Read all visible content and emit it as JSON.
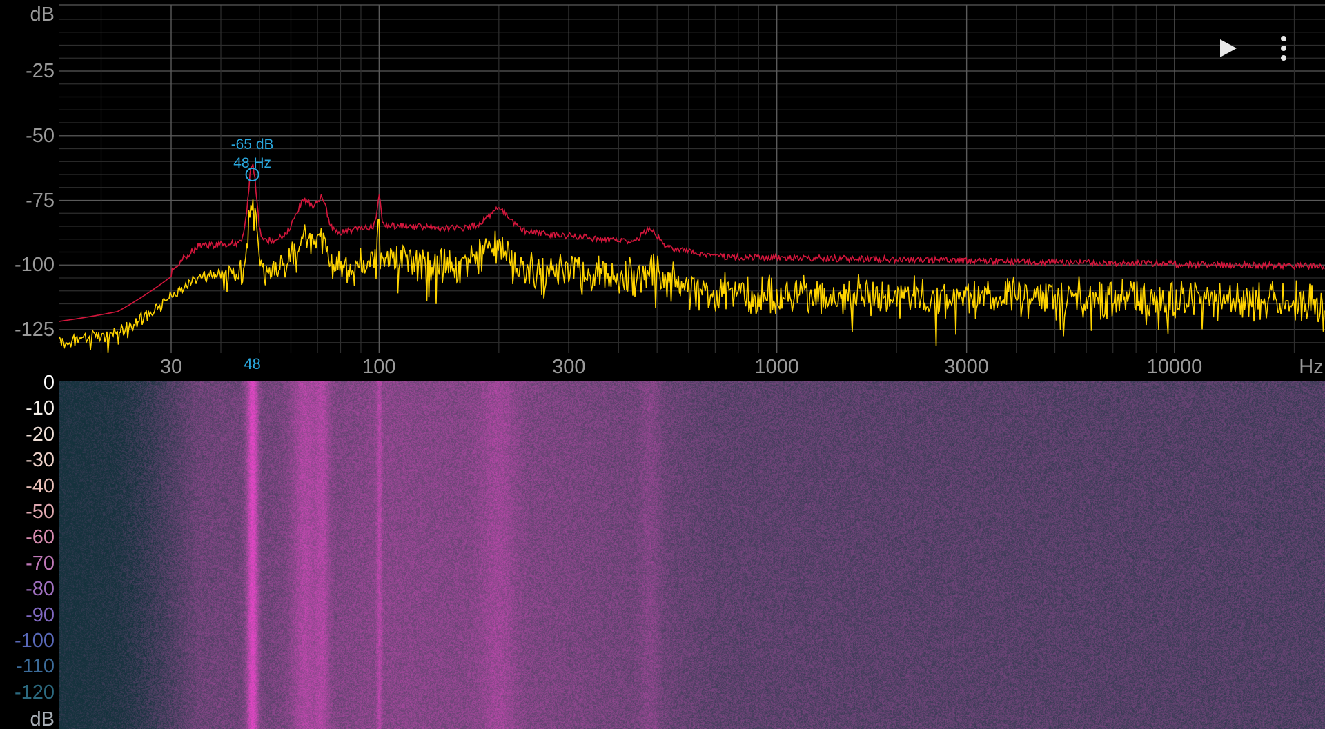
{
  "spectrum": {
    "y_unit": "dB",
    "x_unit": "Hz",
    "y_ticks": [
      "-25",
      "-50",
      "-75",
      "-100",
      "-125"
    ],
    "y_values": [
      -25,
      -50,
      -75,
      -100,
      -125
    ],
    "x_ticks": [
      {
        "label": "30",
        "hz": 30
      },
      {
        "label": "100",
        "hz": 100
      },
      {
        "label": "300",
        "hz": 300
      },
      {
        "label": "1000",
        "hz": 1000
      },
      {
        "label": "3000",
        "hz": 3000
      },
      {
        "label": "10000",
        "hz": 10000
      }
    ],
    "peak": {
      "db_label": "-65 dB",
      "hz_label": "48 Hz",
      "axis_label": "48",
      "hz": 48,
      "db": -65
    },
    "colors": {
      "live": "#ffd400",
      "hold": "#d4163c",
      "peak": "#2aa9e0",
      "grid": "#5a5a5a",
      "grid_minor": "#2e2e2e"
    }
  },
  "spectrogram": {
    "unit": "dB",
    "scale": [
      "0",
      "-10",
      "-20",
      "-30",
      "-40",
      "-50",
      "-60",
      "-70",
      "-80",
      "-90",
      "-100",
      "-110",
      "-120"
    ],
    "scale_colors": [
      "#ffffff",
      "#f5f0ea",
      "#f0e0d8",
      "#ecd0c8",
      "#e8c0b8",
      "#e0a8b0",
      "#d88cb0",
      "#c078b8",
      "#a070c0",
      "#8068c0",
      "#5868b8",
      "#3c6c9a",
      "#2c6a80"
    ]
  },
  "toolbar": {
    "play_icon": "play-icon",
    "menu_icon": "more-vert-icon"
  }
}
